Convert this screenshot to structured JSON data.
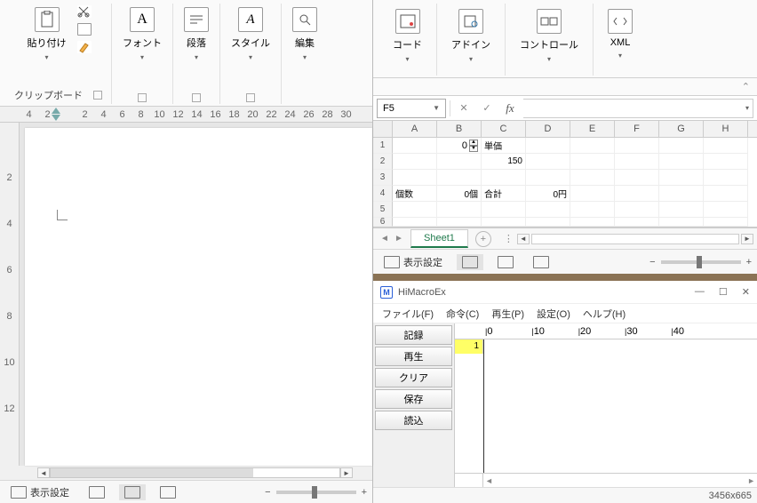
{
  "word": {
    "ribbon": {
      "clipboard": {
        "paste": "貼り付け",
        "label": "クリップボード"
      },
      "font": {
        "label": "フォント"
      },
      "para": {
        "label": "段落"
      },
      "style": {
        "label": "スタイル"
      },
      "edit": {
        "label": "編集"
      }
    },
    "hruler": [
      "4",
      "2",
      "",
      "2",
      "4",
      "6",
      "8",
      "10",
      "12",
      "14",
      "16",
      "18",
      "20",
      "22",
      "24",
      "26",
      "28",
      "30"
    ],
    "vruler": [
      "",
      "",
      "2",
      "",
      "4",
      "",
      "6",
      "",
      "8",
      "",
      "10",
      "",
      "12",
      ""
    ],
    "statusbar": {
      "display": "表示設定"
    }
  },
  "excel": {
    "ribbon": {
      "code": "コード",
      "addin": "アドイン",
      "controls": "コントロール",
      "xml": "XML"
    },
    "namebox": "F5",
    "fx": "fx",
    "cols": [
      "A",
      "B",
      "C",
      "D",
      "E",
      "F",
      "G",
      "H"
    ],
    "rows": {
      "1": {
        "B": "0",
        "C": "単価"
      },
      "2": {
        "C": "150"
      },
      "3": {},
      "4": {
        "A": "個数",
        "B": "0個",
        "C": "合計",
        "D": "0円"
      },
      "5": {},
      "6": {}
    },
    "sheet": "Sheet1",
    "statusbar": {
      "display": "表示設定"
    }
  },
  "himacro": {
    "title": "HiMacroEx",
    "menu": {
      "file": "ファイル(F)",
      "cmd": "命令(C)",
      "play": "再生(P)",
      "settings": "設定(O)",
      "help": "ヘルプ(H)"
    },
    "buttons": {
      "rec": "記録",
      "play": "再生",
      "clear": "クリア",
      "save": "保存",
      "load": "読込"
    },
    "ruler": [
      "0",
      "10",
      "20",
      "30",
      "40"
    ],
    "row1": "1",
    "status": "3456x665"
  }
}
